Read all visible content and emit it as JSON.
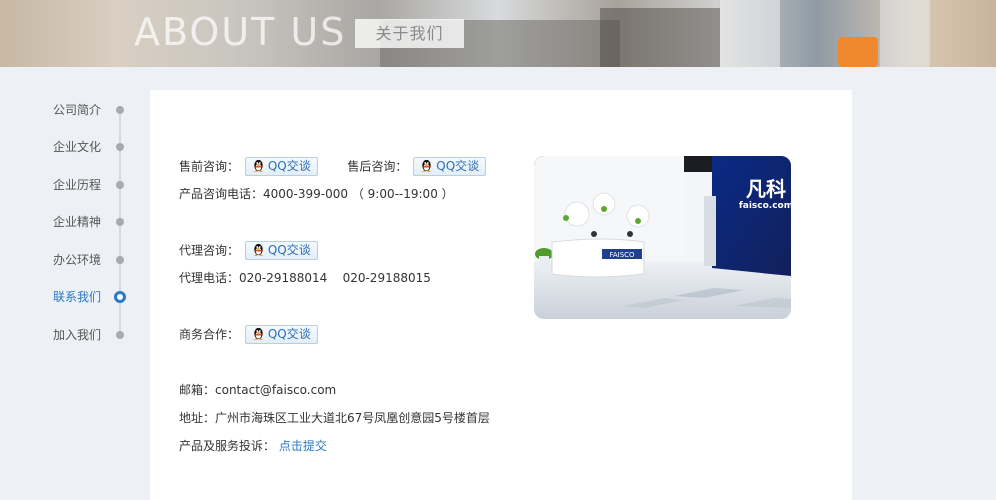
{
  "banner": {
    "title_en": "ABOUT US",
    "title_cn": "关于我们"
  },
  "sidebar": {
    "items": [
      {
        "label": "公司简介",
        "active": false
      },
      {
        "label": "企业文化",
        "active": false
      },
      {
        "label": "企业历程",
        "active": false
      },
      {
        "label": "企业精神",
        "active": false
      },
      {
        "label": "办公环境",
        "active": false
      },
      {
        "label": "联系我们",
        "active": true
      },
      {
        "label": "加入我们",
        "active": false
      }
    ]
  },
  "contact": {
    "presale_label": "售前咨询：",
    "aftersale_label": "售后咨询：",
    "qq_button": "QQ交谈",
    "product_phone": "产品咨询电话：4000-399-000 （ 9:00--19:00 ）",
    "agent_label": "代理咨询：",
    "agent_phone": "代理电话：020-29188014    020-29188015",
    "business_label": "商务合作：",
    "email": "邮箱：contact@faisco.com",
    "address": "地址：广州市海珠区工业大道北67号凤凰创意园5号楼首层",
    "complaint_label": "产品及服务投诉：",
    "complaint_link": "点击提交"
  },
  "photo": {
    "logo_cn": "凡科",
    "logo_en": "faisco.com",
    "desk_sign": "FAISCO"
  },
  "colors": {
    "accent": "#2a78c6",
    "panel_bg": "#ffffff",
    "page_bg": "#edf0f4"
  }
}
